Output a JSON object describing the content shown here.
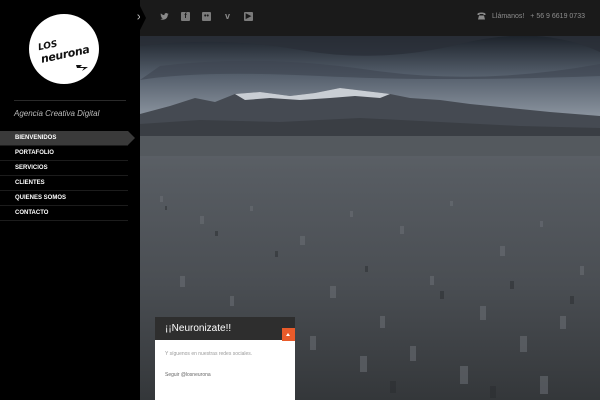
{
  "brand": {
    "logo_line1": "LOS",
    "logo_line2": "neurona",
    "tagline": "Agencia Creativa Digital"
  },
  "nav": {
    "items": [
      {
        "label": "BIENVENIDOS",
        "active": true
      },
      {
        "label": "PORTAFOLIO",
        "active": false
      },
      {
        "label": "SERVICIOS",
        "active": false
      },
      {
        "label": "CLIENTES",
        "active": false
      },
      {
        "label": "QUIENES SOMOS",
        "active": false
      },
      {
        "label": "CONTACTO",
        "active": false
      }
    ]
  },
  "topbar": {
    "close_glyph": "×",
    "social": [
      {
        "name": "twitter-icon",
        "glyph": "🐦"
      },
      {
        "name": "facebook-icon",
        "glyph": "f"
      },
      {
        "name": "flickr-icon",
        "glyph": "••"
      },
      {
        "name": "vimeo-icon",
        "glyph": "v"
      },
      {
        "name": "youtube-icon",
        "glyph": "▶"
      }
    ],
    "phone_label": "Llámanos!",
    "phone_number": "+ 56 9 6619 0733"
  },
  "widget": {
    "title": "¡¡Neuronizate!!",
    "text": "Y síguenos en nuestras redes sociales.",
    "link": "Seguir @losneurona"
  },
  "colors": {
    "accent": "#e95b2a",
    "sidebar": "#000000",
    "topbar": "#1a1a1a"
  }
}
